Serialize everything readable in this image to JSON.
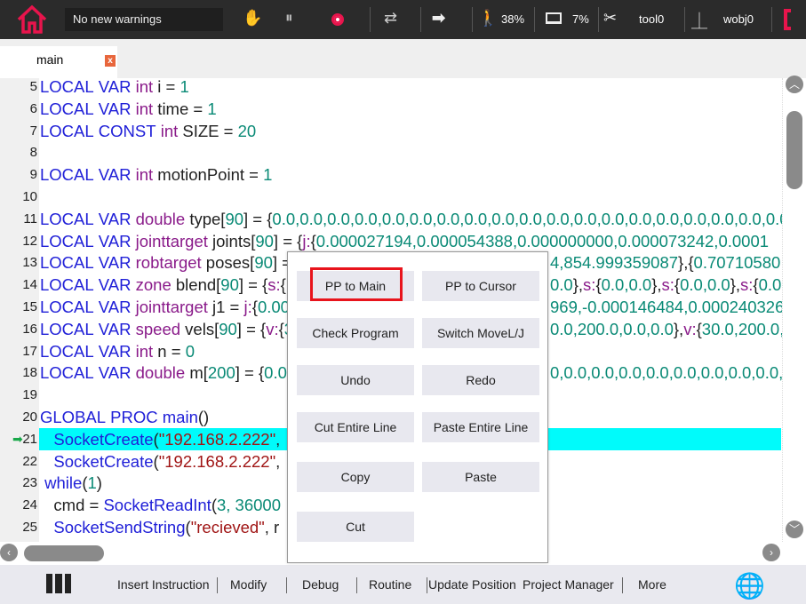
{
  "topbar": {
    "warning": "No new warnings",
    "speed": "38%",
    "load": "7%",
    "tool": "tool0",
    "wobj": "wobj0",
    "icons": [
      "home-icon",
      "hand-icon",
      "pause-icon",
      "record-icon",
      "repeat-icon",
      "step-forward-icon",
      "walk-icon",
      "screen-icon",
      "tool-icon",
      "wobj-icon",
      "robot-icon"
    ],
    "accent": "#e8144c"
  },
  "tab": {
    "label": "main",
    "close": "x"
  },
  "colors": {
    "keyword": "#2020d8",
    "type": "#8a1b8a",
    "number": "#0a8a76",
    "string": "#a01515",
    "highlight": "#00fbfb"
  },
  "code": [
    {
      "n": "5",
      "l": [
        [
          "LOCAL VAR ",
          "kw"
        ],
        [
          "int",
          "ty"
        ],
        [
          " i = ",
          "pl"
        ],
        [
          "1",
          "nu"
        ]
      ]
    },
    {
      "n": "6",
      "l": [
        [
          "LOCAL VAR ",
          "kw"
        ],
        [
          "int",
          "ty"
        ],
        [
          " time = ",
          "pl"
        ],
        [
          "1",
          "nu"
        ]
      ]
    },
    {
      "n": "7",
      "l": [
        [
          "LOCAL CONST ",
          "kw"
        ],
        [
          "int",
          "ty"
        ],
        [
          " SIZE = ",
          "pl"
        ],
        [
          "20",
          "nu"
        ]
      ]
    },
    {
      "n": "8",
      "l": []
    },
    {
      "n": "9",
      "l": [
        [
          "LOCAL VAR ",
          "kw"
        ],
        [
          "int",
          "ty"
        ],
        [
          " motionPoint = ",
          "pl"
        ],
        [
          "1",
          "nu"
        ]
      ]
    },
    {
      "n": "10",
      "l": []
    },
    {
      "n": "11",
      "l": [
        [
          "LOCAL VAR ",
          "kw"
        ],
        [
          "double",
          "ty"
        ],
        [
          " type[",
          "pl"
        ],
        [
          "90",
          "nu"
        ],
        [
          "] = {",
          "pl"
        ],
        [
          "0.0,0.0,0.0,0.0,0.0,0.0,0.0,0.0,0.0,0.0,0.0,0.0,0.0,0.0,0.0,0.0,0.0,0.0,0.0",
          "nu"
        ]
      ]
    },
    {
      "n": "12",
      "l": [
        [
          "LOCAL VAR ",
          "kw"
        ],
        [
          "jointtarget",
          "ty"
        ],
        [
          " joints[",
          "pl"
        ],
        [
          "90",
          "nu"
        ],
        [
          "] = {",
          "pl"
        ],
        [
          "j:",
          "ty"
        ],
        [
          "{",
          "pl"
        ],
        [
          "0.000027194,0.000054388,0.000000000,0.000073242,0.0001",
          "nu"
        ]
      ]
    },
    {
      "n": "13",
      "l": [
        [
          "LOCAL VAR ",
          "kw"
        ],
        [
          "robtarget",
          "ty"
        ],
        [
          " poses[",
          "pl"
        ],
        [
          "90",
          "nu"
        ],
        [
          "] =",
          "pl"
        ]
      ],
      "r": [
        [
          "4,854.999359087",
          "nu"
        ],
        [
          "},{",
          "pl"
        ],
        [
          "0.70710580",
          "nu"
        ]
      ]
    },
    {
      "n": "14",
      "l": [
        [
          "LOCAL VAR ",
          "kw"
        ],
        [
          "zone",
          "ty"
        ],
        [
          " blend[",
          "pl"
        ],
        [
          "90",
          "nu"
        ],
        [
          "] = {",
          "pl"
        ],
        [
          "s:",
          "ty"
        ],
        [
          "{",
          "pl"
        ]
      ],
      "r": [
        [
          "0.0",
          "nu"
        ],
        [
          "},",
          "pl"
        ],
        [
          "s:",
          "ty"
        ],
        [
          "{",
          "pl"
        ],
        [
          "0.0,0.0",
          "nu"
        ],
        [
          "},",
          "pl"
        ],
        [
          "s:",
          "ty"
        ],
        [
          "{",
          "pl"
        ],
        [
          "0.0,0.0",
          "nu"
        ],
        [
          "},",
          "pl"
        ],
        [
          "s:",
          "ty"
        ],
        [
          "{",
          "pl"
        ],
        [
          "0.0,0.",
          "nu"
        ]
      ]
    },
    {
      "n": "15",
      "l": [
        [
          "LOCAL VAR ",
          "kw"
        ],
        [
          "jointtarget",
          "ty"
        ],
        [
          " j1 = ",
          "pl"
        ],
        [
          "j:",
          "ty"
        ],
        [
          "{",
          "pl"
        ],
        [
          "0.00",
          "nu"
        ]
      ],
      "r": [
        [
          "969,-0.000146484,0.000240326",
          "nu"
        ]
      ]
    },
    {
      "n": "16",
      "l": [
        [
          "LOCAL VAR ",
          "kw"
        ],
        [
          "speed",
          "ty"
        ],
        [
          " vels[",
          "pl"
        ],
        [
          "90",
          "nu"
        ],
        [
          "] = {",
          "pl"
        ],
        [
          "v:",
          "ty"
        ],
        [
          "{",
          "pl"
        ],
        [
          "3",
          "nu"
        ]
      ],
      "r": [
        [
          "0.0,200.0,0.0,0.0",
          "nu"
        ],
        [
          "},",
          "pl"
        ],
        [
          "v:",
          "ty"
        ],
        [
          "{",
          "pl"
        ],
        [
          "30.0,200.0,2",
          "nu"
        ]
      ]
    },
    {
      "n": "17",
      "l": [
        [
          "LOCAL VAR ",
          "kw"
        ],
        [
          "int",
          "ty"
        ],
        [
          " n = ",
          "pl"
        ],
        [
          "0",
          "nu"
        ]
      ]
    },
    {
      "n": "18",
      "l": [
        [
          "LOCAL VAR ",
          "kw"
        ],
        [
          "double",
          "ty"
        ],
        [
          " m[",
          "pl"
        ],
        [
          "200",
          "nu"
        ],
        [
          "] = {",
          "pl"
        ],
        [
          "0.0",
          "nu"
        ]
      ],
      "r": [
        [
          "0,0.0,0.0,0.0,0.0,0.0,0.0,0.0,0.0,0.0,0",
          "nu"
        ]
      ]
    },
    {
      "n": "19",
      "l": []
    },
    {
      "n": "20",
      "l": [
        [
          "GLOBAL PROC ",
          "kw"
        ],
        [
          "main",
          "kw"
        ],
        [
          "()",
          "pl"
        ]
      ]
    },
    {
      "n": "21",
      "l": [
        [
          "   SocketCreate",
          "kw"
        ],
        [
          "(",
          "pl"
        ],
        [
          "\"192.168.2.222\"",
          "st"
        ],
        [
          ",",
          "pl"
        ]
      ],
      "hl": true
    },
    {
      "n": "22",
      "l": [
        [
          "   SocketCreate",
          "kw"
        ],
        [
          "(",
          "pl"
        ],
        [
          "\"192.168.2.222\"",
          "st"
        ],
        [
          ",",
          "pl"
        ]
      ]
    },
    {
      "n": "23",
      "l": [
        [
          " while",
          "kw"
        ],
        [
          "(",
          "pl"
        ],
        [
          "1",
          "nu"
        ],
        [
          ")",
          "pl"
        ]
      ]
    },
    {
      "n": "24",
      "l": [
        [
          "   cmd = ",
          "pl"
        ],
        [
          "SocketReadInt",
          "kw"
        ],
        [
          "(",
          "pl"
        ],
        [
          "3, 36000",
          "nu"
        ]
      ]
    },
    {
      "n": "25",
      "l": [
        [
          "   SocketSendString",
          "kw"
        ],
        [
          "(",
          "pl"
        ],
        [
          "\"recieved\"",
          "st"
        ],
        [
          ", r",
          "pl"
        ]
      ]
    }
  ],
  "popup": {
    "items": [
      "PP to Main",
      "PP to Cursor",
      "Check Program",
      "Switch MoveL/J",
      "Undo",
      "Redo",
      "Cut Entire Line",
      "Paste Entire Line",
      "Copy",
      "Paste",
      "Cut"
    ],
    "selected": "PP to Main"
  },
  "bottom": {
    "items": [
      "Insert Instruction",
      "Modify",
      "Debug",
      "Routine",
      "Update Position",
      "Project Manager",
      "More"
    ]
  }
}
